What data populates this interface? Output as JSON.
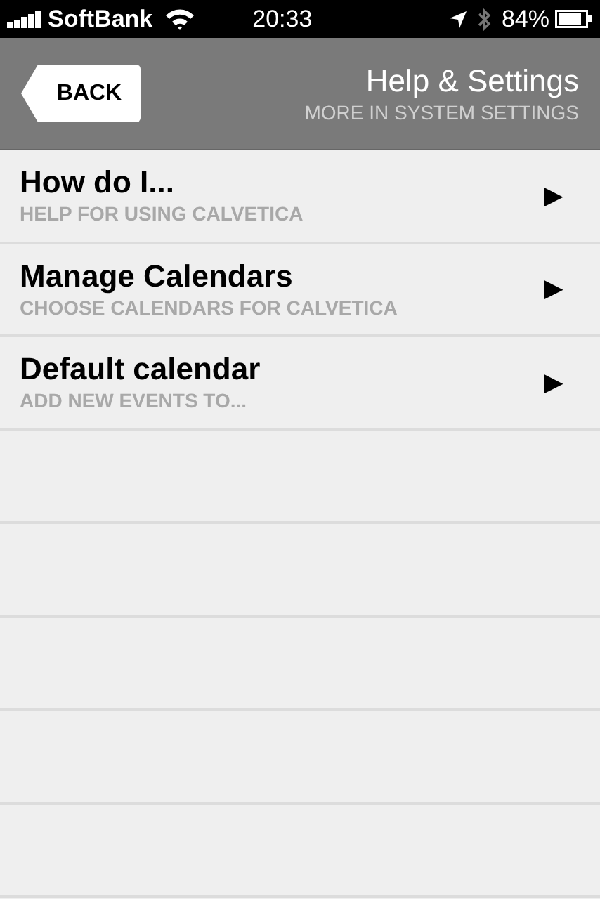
{
  "status_bar": {
    "carrier": "SoftBank",
    "time": "20:33",
    "battery": "84%"
  },
  "nav_bar": {
    "back": "BACK",
    "title": "Help & Settings",
    "subtitle": "MORE IN SYSTEM SETTINGS"
  },
  "items": [
    {
      "title": "How do I...",
      "subtitle": "HELP FOR USING CALVETICA",
      "arrow": "▶"
    },
    {
      "title": "Manage Calendars",
      "subtitle": "CHOOSE CALENDARS FOR CALVETICA",
      "arrow": "▶"
    },
    {
      "title": "Default calendar",
      "subtitle": "ADD NEW EVENTS TO...",
      "arrow": "▶"
    }
  ]
}
